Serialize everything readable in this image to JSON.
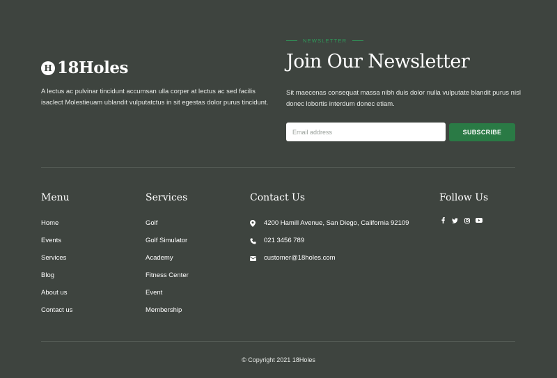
{
  "brand": {
    "badge_letter": "H",
    "name": "18Holes",
    "description": "A lectus ac pulvinar tincidunt accumsan ulla corper at lectus ac sed facilis isaclect Molestieuam ublandit vulputatctus in sit egestas dolor purus tincidunt."
  },
  "newsletter": {
    "kicker": "NEWSLETTER",
    "title": "Join Our Newsletter",
    "text": "Sit maecenas consequat massa nibh duis dolor nulla vulputate blandit purus nisl donec lobortis interdum donec etiam.",
    "email_placeholder": "Email address",
    "email_value": "",
    "subscribe_label": "SUBSCRIBE"
  },
  "menu": {
    "heading": "Menu",
    "items": [
      "Home",
      "Events",
      "Services",
      "Blog",
      "About us",
      "Contact us"
    ]
  },
  "services": {
    "heading": "Services",
    "items": [
      "Golf",
      "Golf Simulator",
      "Academy",
      "Fitness Center",
      "Event",
      "Membership"
    ]
  },
  "contact": {
    "heading": "Contact Us",
    "address": "4200 Hamill Avenue, San Diego, California 92109",
    "phone": "021 3456 789",
    "email": "customer@18holes.com",
    "icons": [
      "map-pin-icon",
      "phone-icon",
      "envelope-icon"
    ]
  },
  "follow": {
    "heading": "Follow Us",
    "icons": [
      "facebook-icon",
      "twitter-icon",
      "instagram-icon",
      "youtube-icon"
    ]
  },
  "footer": {
    "copyright": "© Copyright 2021 18Holes"
  },
  "colors": {
    "background": "#3e443f",
    "accent": "#2a7a45",
    "accent_text": "#2f9a5a",
    "divider": "#535a54",
    "text": "#ffffff"
  }
}
